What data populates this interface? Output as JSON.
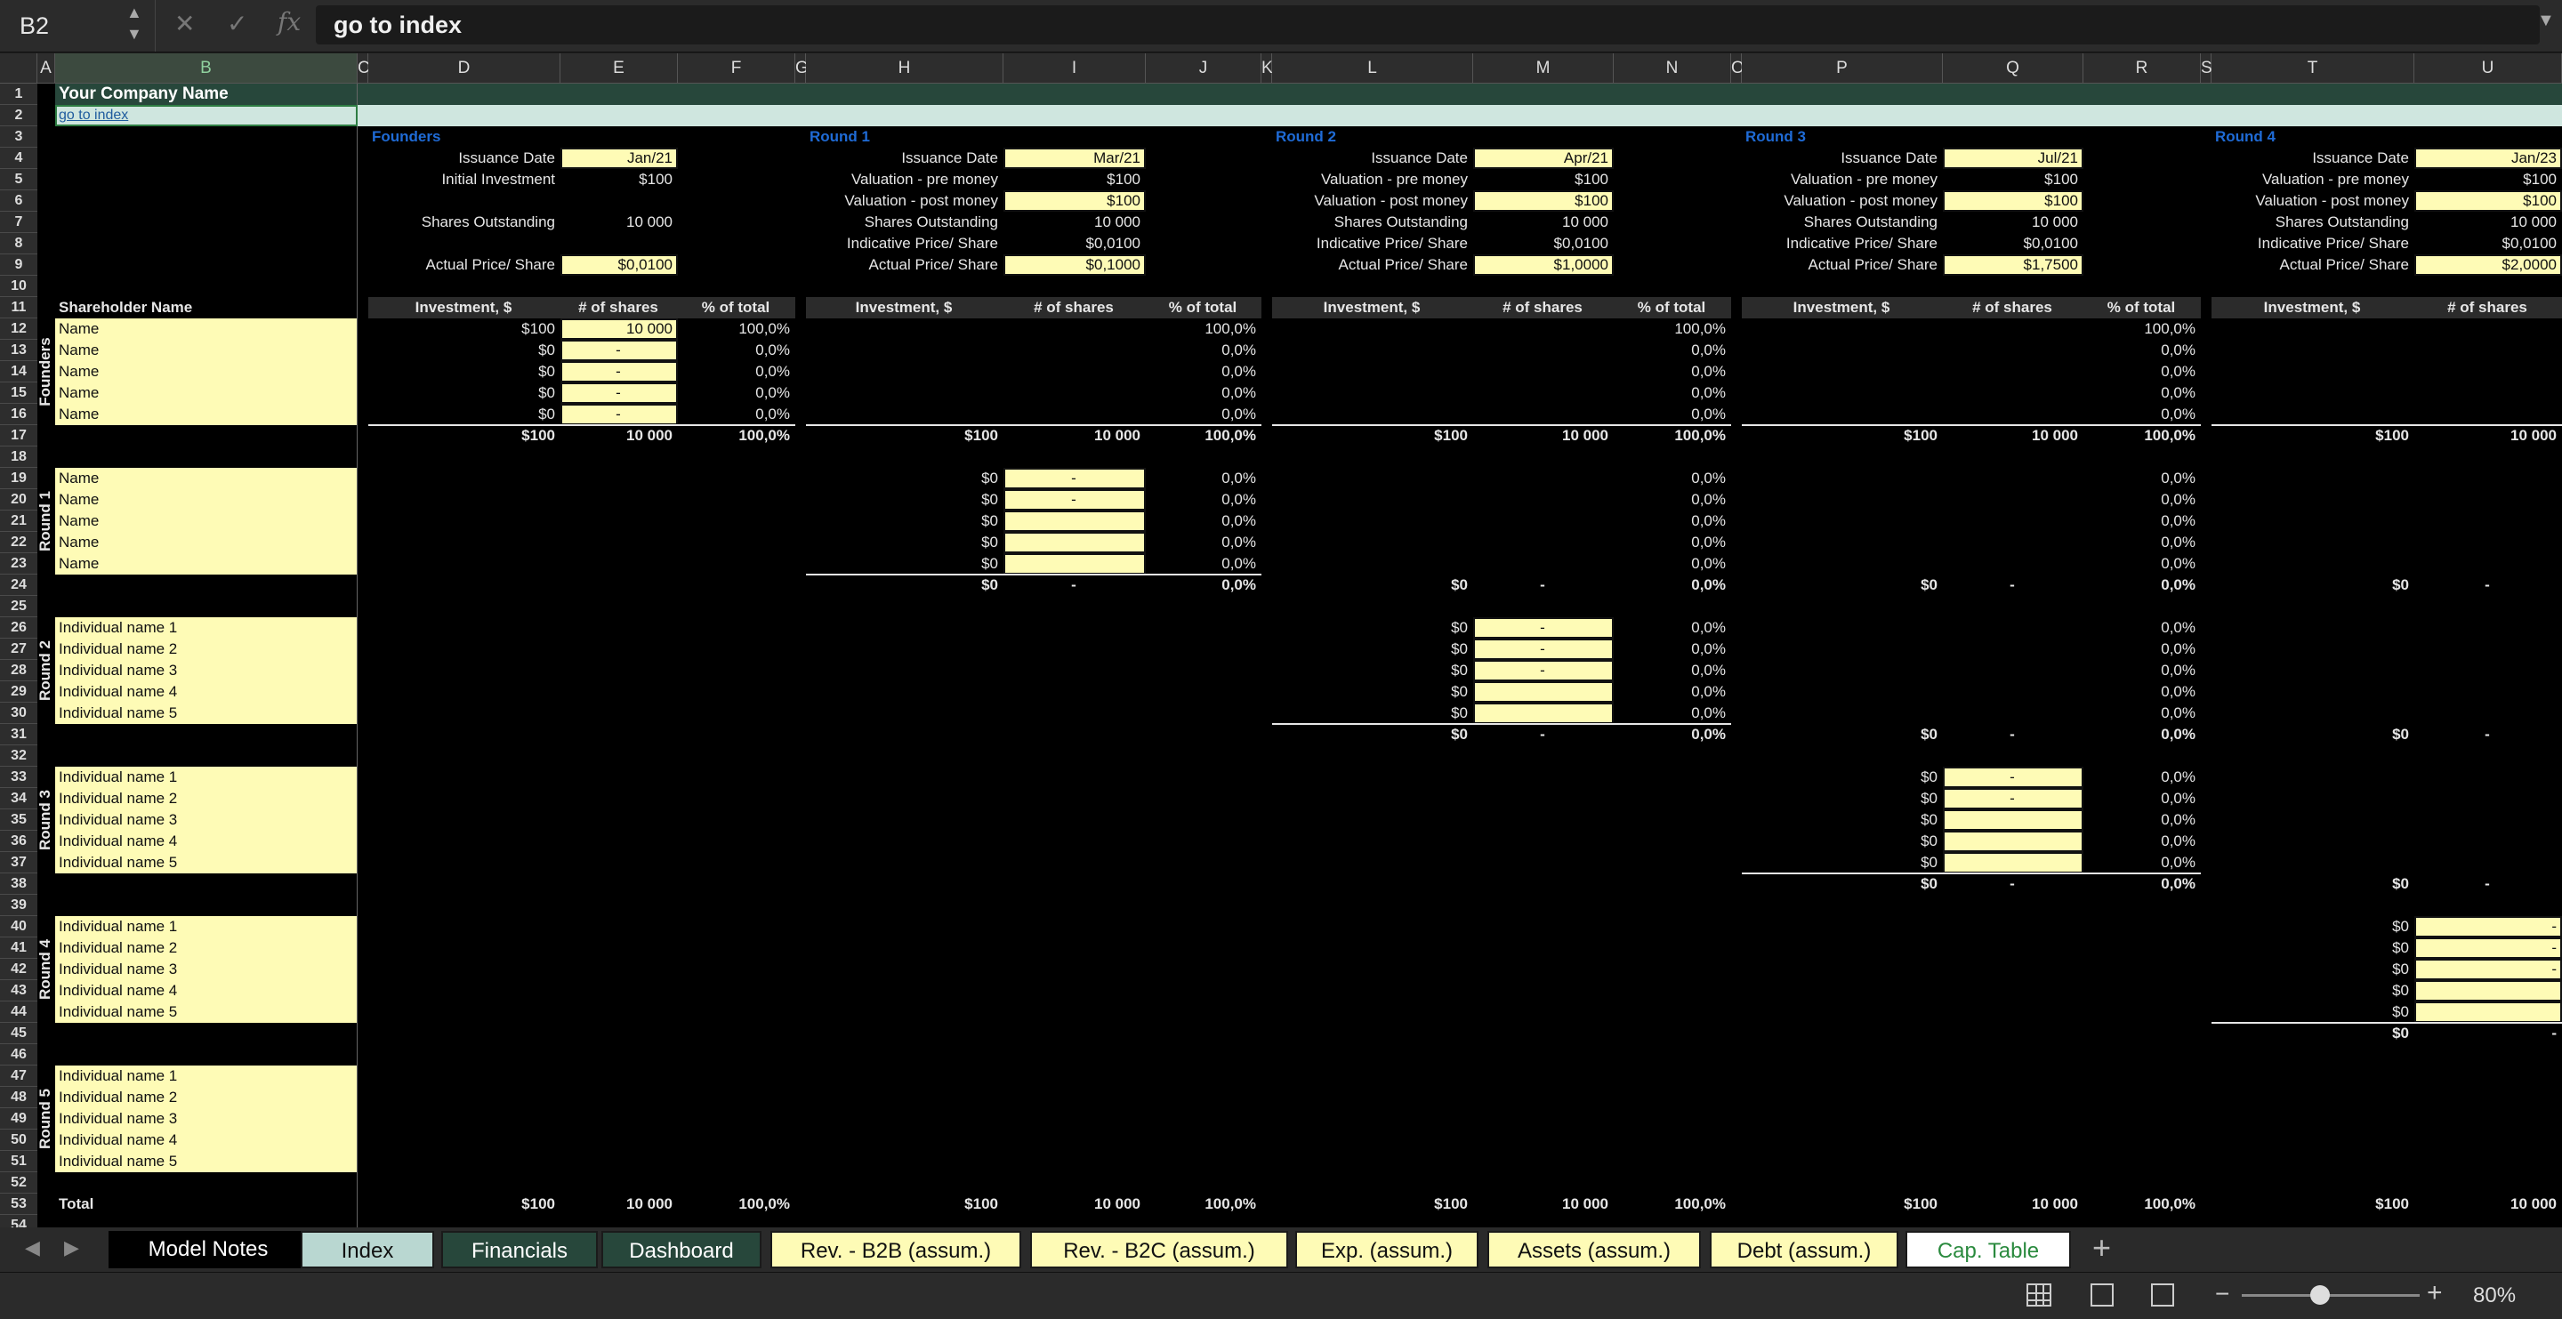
{
  "formula_bar": {
    "name_box": "B2",
    "formula": "go to index",
    "fx": "fx"
  },
  "columns": [
    "A",
    "B",
    "C",
    "D",
    "E",
    "F",
    "G",
    "H",
    "I",
    "J",
    "K",
    "L",
    "M",
    "N",
    "O",
    "P",
    "Q",
    "R",
    "S",
    "T",
    "U"
  ],
  "company_name": "Your Company Name",
  "go_to_index": "go to index",
  "shareholder_header": "Shareholder Name",
  "table_headers": {
    "investment": "Investment, $",
    "shares": "# of shares",
    "pct": "% of total"
  },
  "labels": {
    "issuance": "Issuance Date",
    "initial": "Initial Investment",
    "pre": "Valuation - pre money",
    "post": "Valuation - post money",
    "shares_out": "Shares Outstanding",
    "indicative": "Indicative Price/ Share",
    "actual": "Actual Price/ Share"
  },
  "founders_block": {
    "title": "Founders",
    "issuance": "Jan/21",
    "initial": "$100",
    "shares_out": "10 000",
    "actual": "$0,0100"
  },
  "rounds": [
    {
      "title": "Round 1",
      "issuance": "Mar/21",
      "pre": "$100",
      "post": "$100",
      "shares_out": "10 000",
      "indicative": "$0,0100",
      "actual": "$0,1000"
    },
    {
      "title": "Round 2",
      "issuance": "Apr/21",
      "pre": "$100",
      "post": "$100",
      "shares_out": "10 000",
      "indicative": "$0,0100",
      "actual": "$1,0000"
    },
    {
      "title": "Round 3",
      "issuance": "Jul/21",
      "pre": "$100",
      "post": "$100",
      "shares_out": "10 000",
      "indicative": "$0,0100",
      "actual": "$1,7500"
    },
    {
      "title": "Round 4",
      "issuance": "Jan/23",
      "pre": "$100",
      "post": "$100",
      "shares_out": "10 000",
      "indicative": "$0,0100",
      "actual": "$2,0000"
    }
  ],
  "group_labels": [
    "Founders",
    "Round 1",
    "Round 2",
    "Round 3",
    "Round 4",
    "Round 5"
  ],
  "name_generic": "Name",
  "individual_names": [
    "Individual name 1",
    "Individual name 2",
    "Individual name 3",
    "Individual name 4",
    "Individual name 5"
  ],
  "total_label": "Total",
  "values": {
    "usd100": "$100",
    "usd0": "$0",
    "shares10k": "10 000",
    "dash": "-",
    "pct100": "100,0%",
    "pct0": "0,0%"
  },
  "sheet_tabs": [
    {
      "label": "Model Notes",
      "bg": "#000000",
      "fg": "#ffffff"
    },
    {
      "label": "Index",
      "bg": "#b9d7d1",
      "fg": "#111111"
    },
    {
      "label": "Financials",
      "bg": "#27473b",
      "fg": "#ffffff"
    },
    {
      "label": "Dashboard",
      "bg": "#27473b",
      "fg": "#ffffff"
    },
    {
      "label": "Rev. - B2B (assum.)",
      "bg": "#fefbb6",
      "fg": "#111111"
    },
    {
      "label": "Rev. - B2C (assum.)",
      "bg": "#fefbb6",
      "fg": "#111111"
    },
    {
      "label": "Exp. (assum.)",
      "bg": "#fefbb6",
      "fg": "#111111"
    },
    {
      "label": "Assets (assum.)",
      "bg": "#fefbb6",
      "fg": "#111111"
    },
    {
      "label": "Debt (assum.)",
      "bg": "#fefbb6",
      "fg": "#111111"
    },
    {
      "label": "Cap. Table",
      "bg": "#ffffff",
      "fg": "#2a8a3e"
    }
  ],
  "add_sheet": "+",
  "zoom": "80%",
  "zoom_level_percent": 80
}
